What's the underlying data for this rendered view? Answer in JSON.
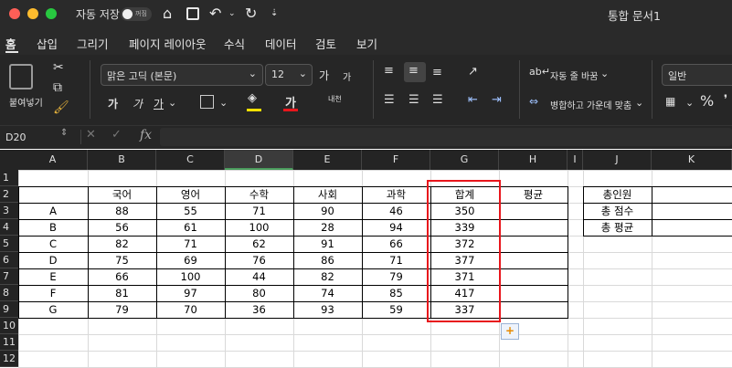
{
  "titlebar": {
    "autosave_label": "자동 저장",
    "autosave_state": "꺼짐",
    "doc_title": "통합 문서1",
    "icons": [
      "home-icon",
      "save-icon",
      "undo-icon",
      "redo-icon",
      "customize-icon"
    ],
    "traffic_colors": [
      "#ff5f57",
      "#febc2e",
      "#28c840"
    ]
  },
  "tabs": [
    "홈",
    "삽입",
    "그리기",
    "페이지 레이아웃",
    "수식",
    "데이터",
    "검토",
    "보기"
  ],
  "ribbon": {
    "paste_label": "붙여넣기",
    "font_name": "맑은 고딕 (본문)",
    "font_size": "12",
    "grow_font": "가",
    "shrink_font": "가",
    "bold": "가",
    "italic": "가",
    "underline": "가",
    "font_color_glyph": "가",
    "phonetic": "내천",
    "wrap_text": "자동 줄 바꿈",
    "merge_center": "병합하고 가운데 맞춤",
    "number_format": "일반",
    "percent": "%"
  },
  "formula_bar": {
    "name_box": "D20",
    "fx": "fx",
    "content": ""
  },
  "grid": {
    "columns": [
      "A",
      "B",
      "C",
      "D",
      "E",
      "F",
      "G",
      "H",
      "I",
      "J",
      "K"
    ],
    "rows": [
      "1",
      "2",
      "3",
      "4",
      "5",
      "6",
      "7",
      "8",
      "9",
      "10",
      "11",
      "12"
    ],
    "headers": [
      "국어",
      "영어",
      "수학",
      "사회",
      "과학",
      "합계",
      "평균"
    ],
    "students": [
      "A",
      "B",
      "C",
      "D",
      "E",
      "F",
      "G"
    ],
    "scores": [
      [
        "88",
        "55",
        "71",
        "90",
        "46",
        "350",
        ""
      ],
      [
        "56",
        "61",
        "100",
        "28",
        "94",
        "339",
        ""
      ],
      [
        "82",
        "71",
        "62",
        "91",
        "66",
        "372",
        ""
      ],
      [
        "75",
        "69",
        "76",
        "86",
        "71",
        "377",
        ""
      ],
      [
        "66",
        "100",
        "44",
        "82",
        "79",
        "371",
        ""
      ],
      [
        "81",
        "97",
        "80",
        "74",
        "85",
        "417",
        ""
      ],
      [
        "79",
        "70",
        "36",
        "93",
        "59",
        "337",
        ""
      ]
    ],
    "summary_labels": [
      "총인원",
      "총 점수",
      "총 평균"
    ],
    "summary_values": [
      "",
      "",
      ""
    ]
  },
  "colors": {
    "highlight_border": "#e8161c",
    "selected_column_underline": "#4a9c5d"
  }
}
